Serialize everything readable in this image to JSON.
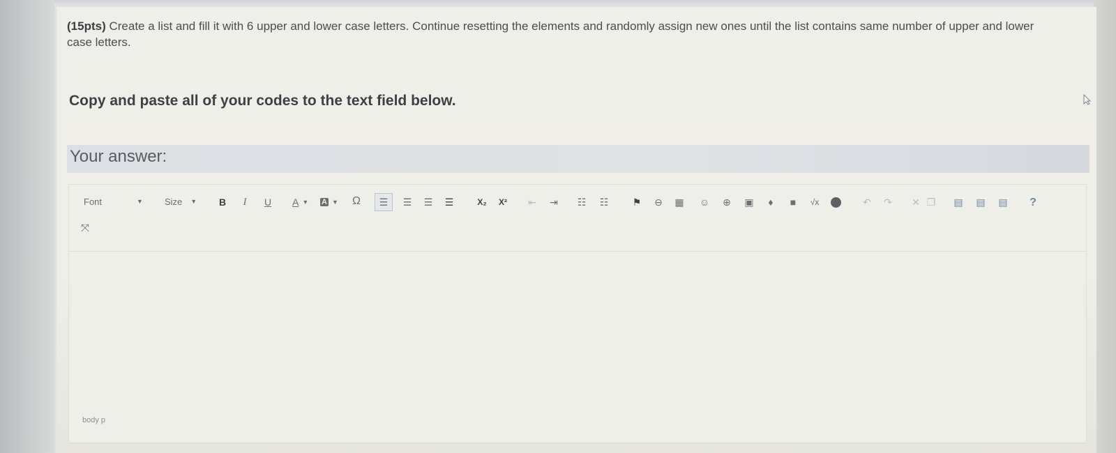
{
  "question": {
    "points": "(15pts)",
    "text": "Create a list and fill it with 6 upper and lower case letters. Continue resetting the elements and randomly assign new ones until the list contains same number of upper and lower case letters."
  },
  "instruction": "Copy and paste all of your codes to the text field below.",
  "answer_label": "Your answer:",
  "toolbar": {
    "font_label": "Font",
    "size_label": "Size",
    "bold": "B",
    "italic": "I",
    "underline": "U",
    "text_color": "A",
    "bg_color": "A",
    "special_char": "Ω",
    "subscript": "X₂",
    "superscript": "X²",
    "help": "?"
  },
  "status_path": "body  p",
  "colors": {
    "background": "#eeeee9",
    "answer_bar": "#dcdfe3",
    "toolbar_icon": "#6b6f74",
    "disabled_icon": "#b9bcbf"
  }
}
